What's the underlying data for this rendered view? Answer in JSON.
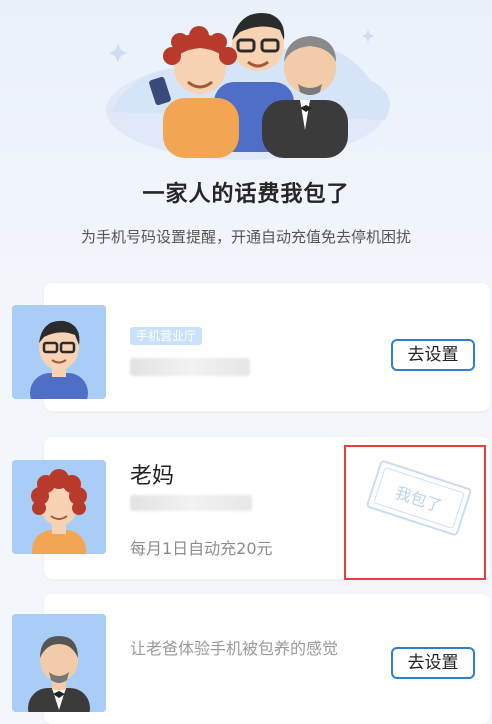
{
  "header": {
    "title": "一家人的话费我包了",
    "subtitle": "为手机号码设置提醒，开通自动充值免去停机困扰"
  },
  "cards": [
    {
      "tag": "手机营业厅",
      "button": "去设置"
    },
    {
      "name": "老妈",
      "auto_recharge": "每月1日自动充20元",
      "stamp": "我包了"
    },
    {
      "text": "让老爸体验手机被包养的感觉",
      "button": "去设置"
    }
  ],
  "colors": {
    "accent": "#2f7fd0",
    "highlight": "#e5403c",
    "tag_bg": "#c9e1fb"
  },
  "icons": [
    "family-illustration",
    "son-avatar",
    "mom-avatar",
    "dad-avatar",
    "stamp-icon"
  ]
}
